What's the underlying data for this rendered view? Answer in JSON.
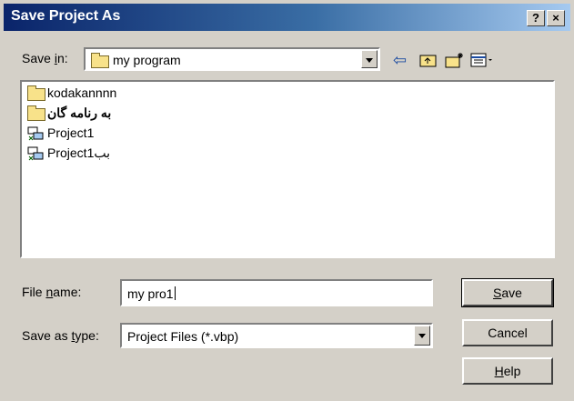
{
  "window": {
    "title": "Save Project As",
    "help_glyph": "?",
    "close_glyph": "×"
  },
  "save_in": {
    "label_before": "Save ",
    "label_mnemonic": "i",
    "label_after": "n:",
    "value": "my program"
  },
  "toolbar": {
    "back_glyph": "⇦"
  },
  "files": [
    {
      "name": "kodakannnn",
      "icon": "folder-icon"
    },
    {
      "name": "به رنامه گان",
      "icon": "folder-icon"
    },
    {
      "name": "Project1",
      "icon": "vb-project-icon"
    },
    {
      "name": "Project1بب",
      "icon": "vb-project-icon"
    }
  ],
  "file_name": {
    "label_before": "File ",
    "label_mnemonic": "n",
    "label_after": "ame:",
    "value": "my pro1"
  },
  "save_as_type": {
    "label_before": "Save as ",
    "label_mnemonic": "t",
    "label_after": "ype:",
    "value": "Project Files (*.vbp)"
  },
  "buttons": {
    "save": {
      "mnemonic": "S",
      "rest": "ave"
    },
    "cancel": "Cancel",
    "help": {
      "mnemonic": "H",
      "rest": "elp"
    }
  }
}
